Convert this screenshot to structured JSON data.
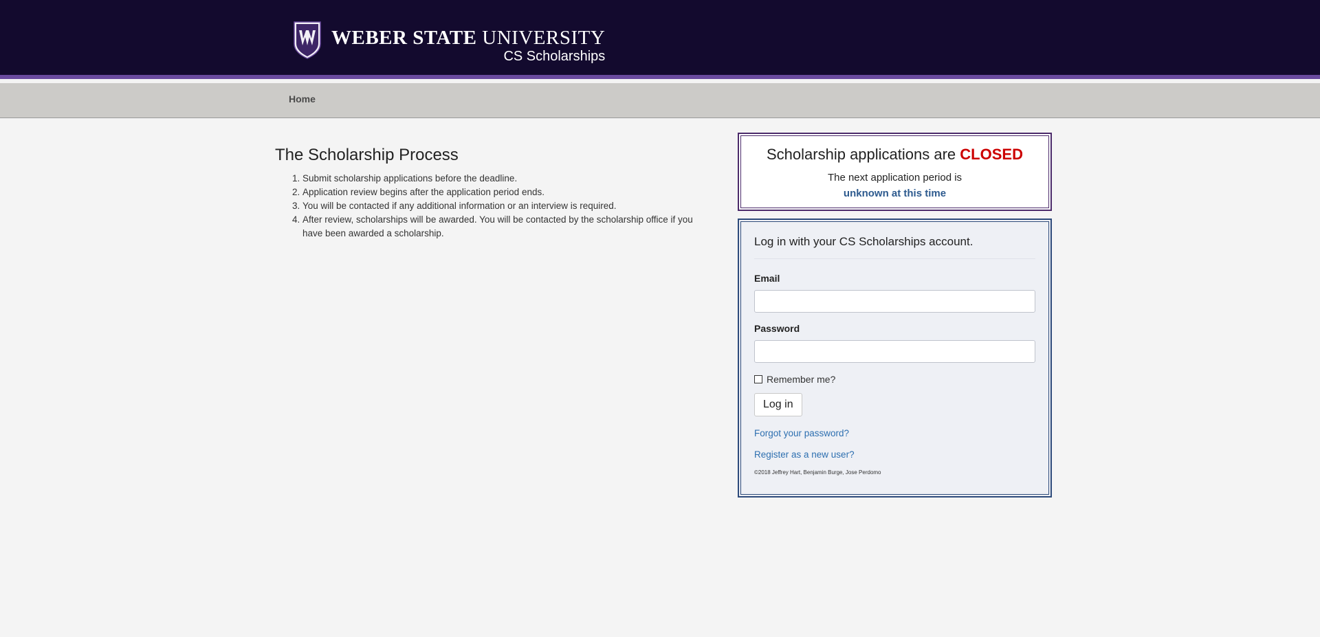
{
  "header": {
    "university_bold": "WEBER STATE",
    "university_rest": "UNIVERSITY",
    "site_name": "CS Scholarships",
    "colors": {
      "header_bg": "#130a2e",
      "accent_purple": "#6a4a9e"
    },
    "logo_icon": "weber-state-shield-icon"
  },
  "nav": {
    "home_label": "Home"
  },
  "process": {
    "title": "The Scholarship Process",
    "steps": [
      "Submit scholarship applications before the deadline.",
      "Application review begins after the application period ends.",
      "You will be contacted if any additional information or an interview is required.",
      "After review, scholarships will be awarded. You will be contacted by the scholarship office if you have been awarded a scholarship."
    ]
  },
  "status": {
    "title_prefix": "Scholarship applications are",
    "title_status": "CLOSED",
    "next_line": "The next application period is",
    "next_when": "unknown at this time",
    "colors": {
      "closed": "#cc0000",
      "link_blue": "#2d5a8e"
    }
  },
  "login": {
    "heading": "Log in with your CS Scholarships account.",
    "email_label": "Email",
    "email_value": "",
    "password_label": "Password",
    "password_value": "",
    "remember_label": "Remember me?",
    "remember_checked": false,
    "submit_label": "Log in",
    "forgot_link": "Forgot your password?",
    "register_link": "Register as a new user?",
    "copyright": "©2018 Jeffrey Hart, Benjamin Burge, Jose Perdomo"
  }
}
